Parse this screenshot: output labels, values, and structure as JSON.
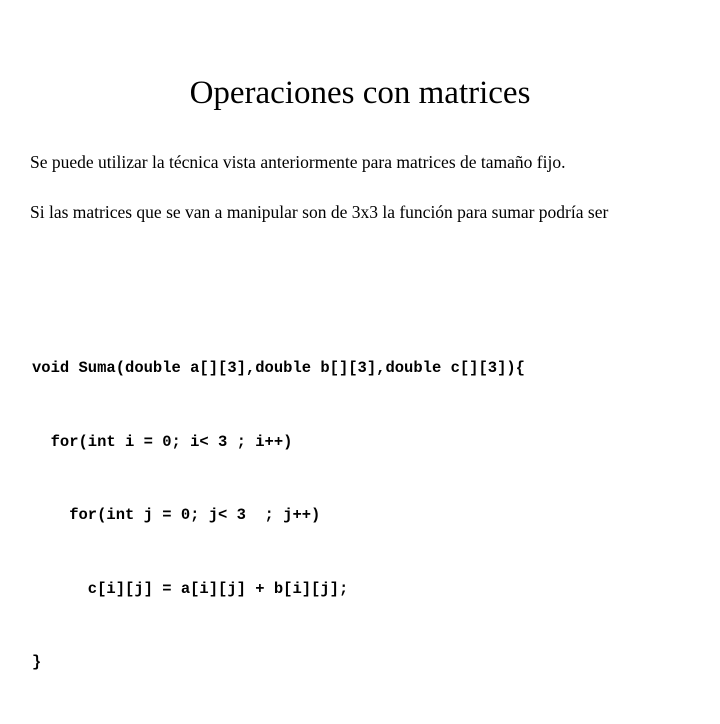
{
  "slide": {
    "title": "Operaciones con matrices",
    "paragraphs": [
      "Se puede utilizar la técnica vista anteriormente para matrices de tamaño fijo.",
      "Si las matrices que se van a manipular son de 3x3 la función para sumar podría ser"
    ],
    "code_lines": [
      "void Suma(double a[][3],double b[][3],double c[][3]){",
      "  for(int i = 0; i< 3 ; i++)",
      "    for(int j = 0; j< 3  ; j++)",
      "      c[i][j] = a[i][j] + b[i][j];",
      "}"
    ]
  },
  "colors": {
    "background": "#ffffff",
    "text": "#000000"
  }
}
